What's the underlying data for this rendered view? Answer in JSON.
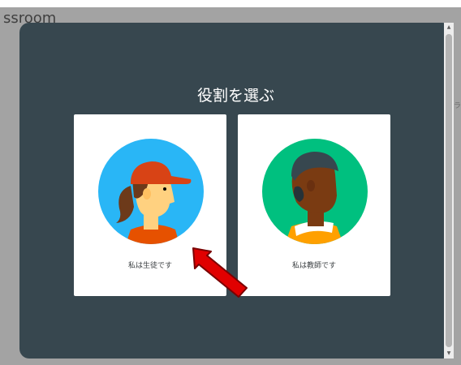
{
  "app": {
    "title_partial": "ssroom"
  },
  "background": {
    "edge_text": "ラ"
  },
  "dialog": {
    "title": "役割を選ぶ",
    "options": [
      {
        "label": "私は生徒です",
        "avatar": "student-avatar"
      },
      {
        "label": "私は教師です",
        "avatar": "teacher-avatar"
      }
    ]
  },
  "annotation": {
    "arrow_color": "#e00000"
  },
  "colors": {
    "dialog_bg": "#37474f",
    "card_bg": "#ffffff",
    "student_circle": "#29b6f6",
    "teacher_circle": "#00c07f"
  },
  "scrollbar": {
    "up_icon": "▲",
    "down_icon": "▼"
  }
}
